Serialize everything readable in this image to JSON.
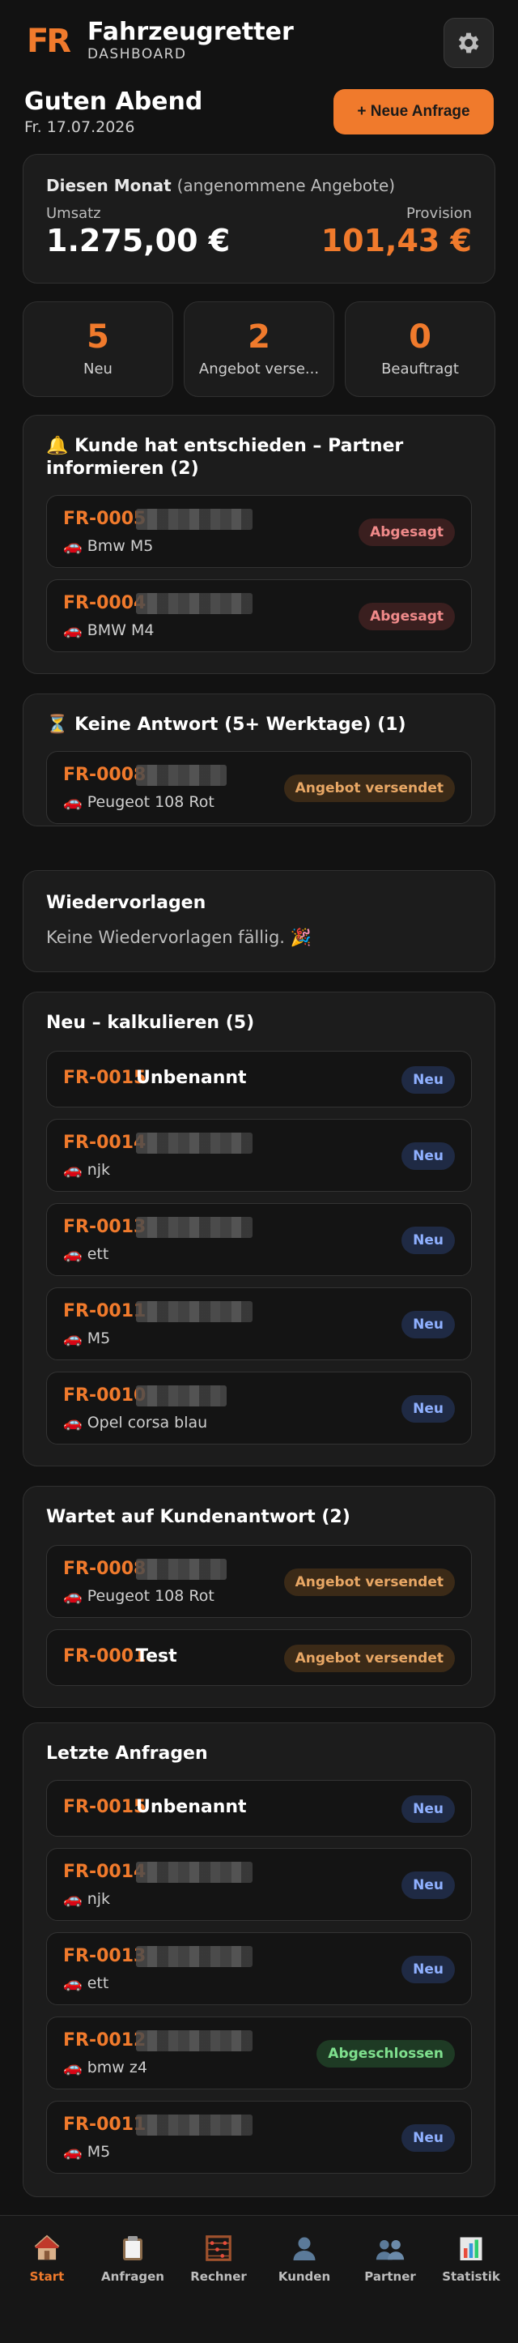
{
  "header": {
    "logo_text": "FR",
    "title": "Fahrzeugretter",
    "subtitle": "DASHBOARD",
    "settings_icon": "gear-icon"
  },
  "greeting": {
    "title": "Guten Abend",
    "date": "Fr. 17.07.2026",
    "new_button": "+ Neue Anfrage"
  },
  "month": {
    "label": "Diesen Monat",
    "label_note": "(angenommene Angebote)",
    "revenue_label": "Umsatz",
    "revenue_value": "1.275,00 €",
    "commission_label": "Provision",
    "commission_value": "101,43 €"
  },
  "stats": [
    {
      "value": "5",
      "label": "Neu"
    },
    {
      "value": "2",
      "label": "Angebot verse..."
    },
    {
      "value": "0",
      "label": "Beauftragt"
    }
  ],
  "sections": {
    "decided": {
      "icon": "🔔",
      "title": "Kunde hat entschieden – Partner informieren (2)",
      "items": [
        {
          "id": "FR-0005",
          "car": "🚗 Bmw M5",
          "badge": "Abgesagt"
        },
        {
          "id": "FR-0004",
          "car": "🚗 BMW M4",
          "badge": "Abgesagt"
        }
      ]
    },
    "no_answer": {
      "icon": "⏳",
      "title": "Keine Antwort (5+ Werktage) (1)",
      "items": [
        {
          "id": "FR-0008",
          "car": "🚗 Peugeot 108 Rot",
          "badge": "Angebot versendet"
        }
      ]
    },
    "followups": {
      "title": "Wiedervorlagen",
      "text": "Keine Wiedervorlagen fällig. 🎉"
    },
    "new": {
      "title": "Neu – kalkulieren (5)",
      "items": [
        {
          "id": "FR-0015",
          "name": "Unbenannt",
          "car": "",
          "badge": "Neu"
        },
        {
          "id": "FR-0014",
          "car": "🚗 njk",
          "badge": "Neu"
        },
        {
          "id": "FR-0013",
          "car": "🚗 ett",
          "badge": "Neu"
        },
        {
          "id": "FR-0011",
          "car": "🚗 M5",
          "badge": "Neu"
        },
        {
          "id": "FR-0010",
          "car": "🚗 Opel corsa blau",
          "badge": "Neu"
        }
      ]
    },
    "waiting": {
      "title": "Wartet auf Kundenantwort (2)",
      "items": [
        {
          "id": "FR-0008",
          "car": "🚗 Peugeot 108 Rot",
          "badge": "Angebot versendet"
        },
        {
          "id": "FR-0001",
          "name": "Test",
          "badge": "Angebot versendet"
        }
      ]
    },
    "recent": {
      "title": "Letzte Anfragen",
      "items": [
        {
          "id": "FR-0015",
          "name": "Unbenannt",
          "badge": "Neu"
        },
        {
          "id": "FR-0014",
          "car": "🚗 njk",
          "badge": "Neu"
        },
        {
          "id": "FR-0013",
          "car": "🚗 ett",
          "badge": "Neu"
        },
        {
          "id": "FR-0012",
          "car": "🚗 bmw z4",
          "badge": "Abgeschlossen"
        },
        {
          "id": "FR-0011",
          "car": "🚗 M5",
          "badge": "Neu"
        }
      ]
    }
  },
  "nav": [
    {
      "label": "Start",
      "icon": "house-icon",
      "active": true
    },
    {
      "label": "Anfragen",
      "icon": "clipboard-icon"
    },
    {
      "label": "Rechner",
      "icon": "abacus-icon"
    },
    {
      "label": "Kunden",
      "icon": "person-icon"
    },
    {
      "label": "Partner",
      "icon": "people-icon"
    },
    {
      "label": "Statistik",
      "icon": "bar-chart-icon"
    }
  ],
  "colors": {
    "accent": "#f07a2c",
    "background": "#121212",
    "card": "#1c1c1c"
  }
}
